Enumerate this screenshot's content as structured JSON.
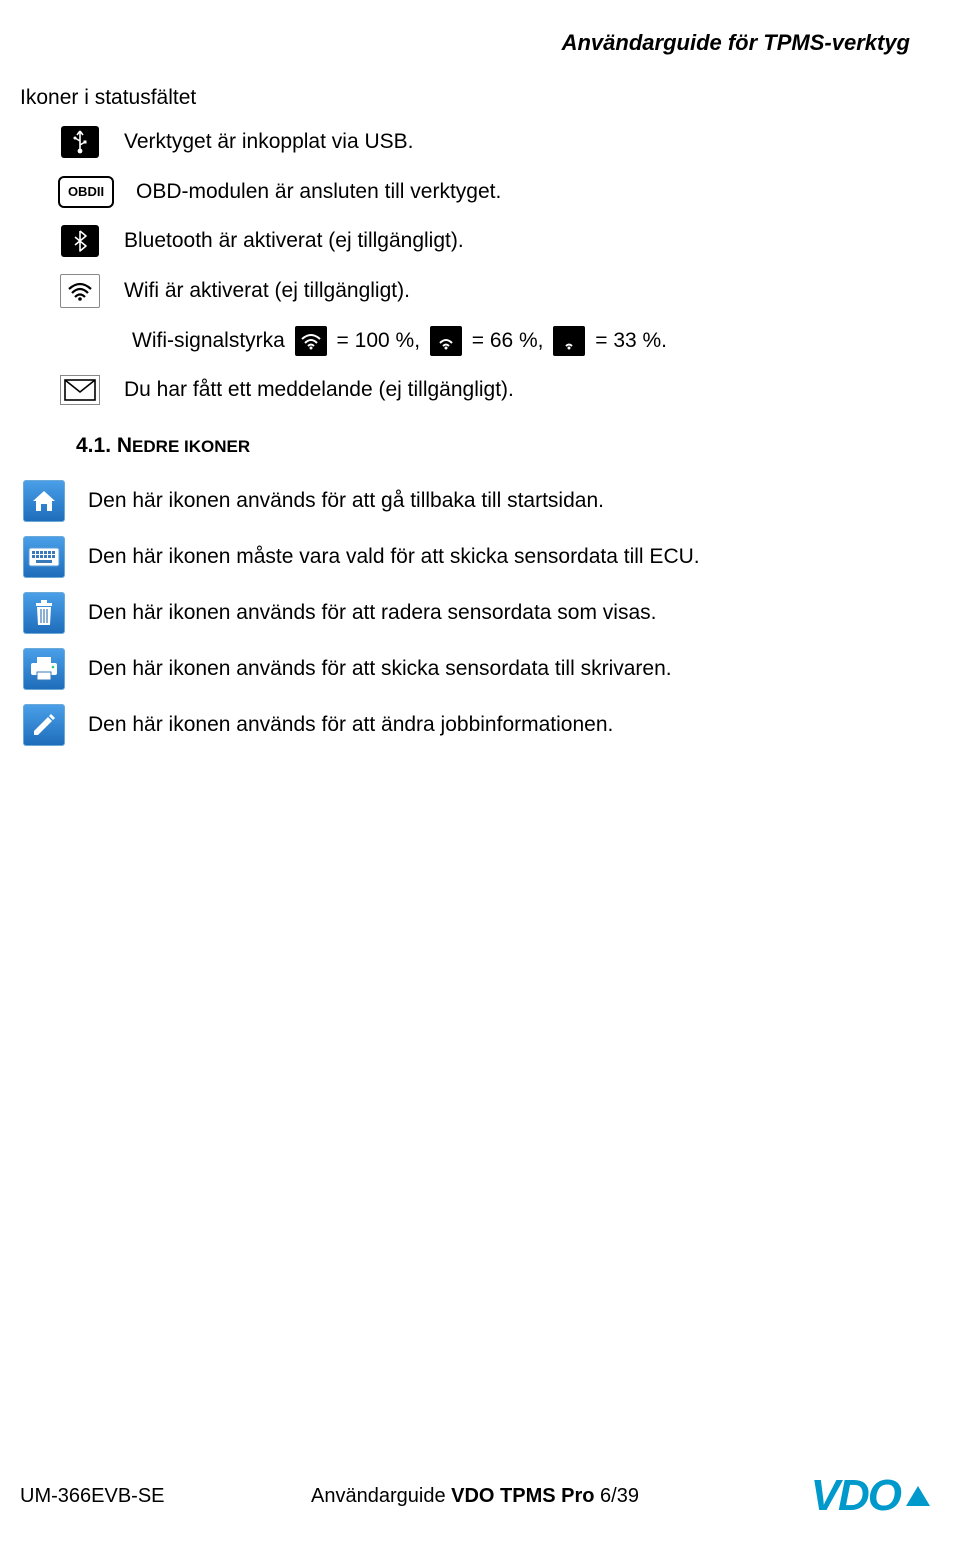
{
  "header": {
    "title": "Användarguide för TPMS-verktyg"
  },
  "status_section": {
    "heading": "Ikoner i statusfältet",
    "items": [
      {
        "icon": "usb-icon",
        "text": "Verktyget är inkopplat via USB."
      },
      {
        "icon": "obdii-icon",
        "label": "OBDII",
        "text": "OBD-modulen är ansluten till verktyget."
      },
      {
        "icon": "bluetooth-icon",
        "text": "Bluetooth är aktiverat (ej tillgängligt)."
      },
      {
        "icon": "wifi-icon",
        "text": "Wifi är aktiverat (ej tillgängligt)."
      }
    ],
    "wifi_signal": {
      "prefix": "Wifi-signalstyrka",
      "level_100": "= 100 %,",
      "level_66": "= 66 %,",
      "level_33": "= 33 %."
    },
    "message_item": {
      "icon": "mail-icon",
      "text": "Du har fått ett meddelande (ej tillgängligt)."
    }
  },
  "nedre_section": {
    "heading_num": "4.1.",
    "heading_text": "NEDRE IKONER",
    "items": [
      {
        "icon": "home-icon",
        "text": "Den här ikonen används för att gå tillbaka till startsidan."
      },
      {
        "icon": "keyboard-icon",
        "text": "Den här ikonen måste vara vald för att skicka sensordata till ECU."
      },
      {
        "icon": "trash-icon",
        "text": "Den här ikonen används för att radera sensordata som visas."
      },
      {
        "icon": "printer-icon",
        "text": "Den här ikonen används för att skicka sensordata till skrivaren."
      },
      {
        "icon": "edit-icon",
        "text": "Den här ikonen används för att ändra jobbinformationen."
      }
    ]
  },
  "footer": {
    "left": "UM-366EVB-SE",
    "center_prefix": "Användarguide ",
    "center_bold": "VDO TPMS Pro ",
    "center_page": "6/39",
    "logo": "VDO"
  }
}
